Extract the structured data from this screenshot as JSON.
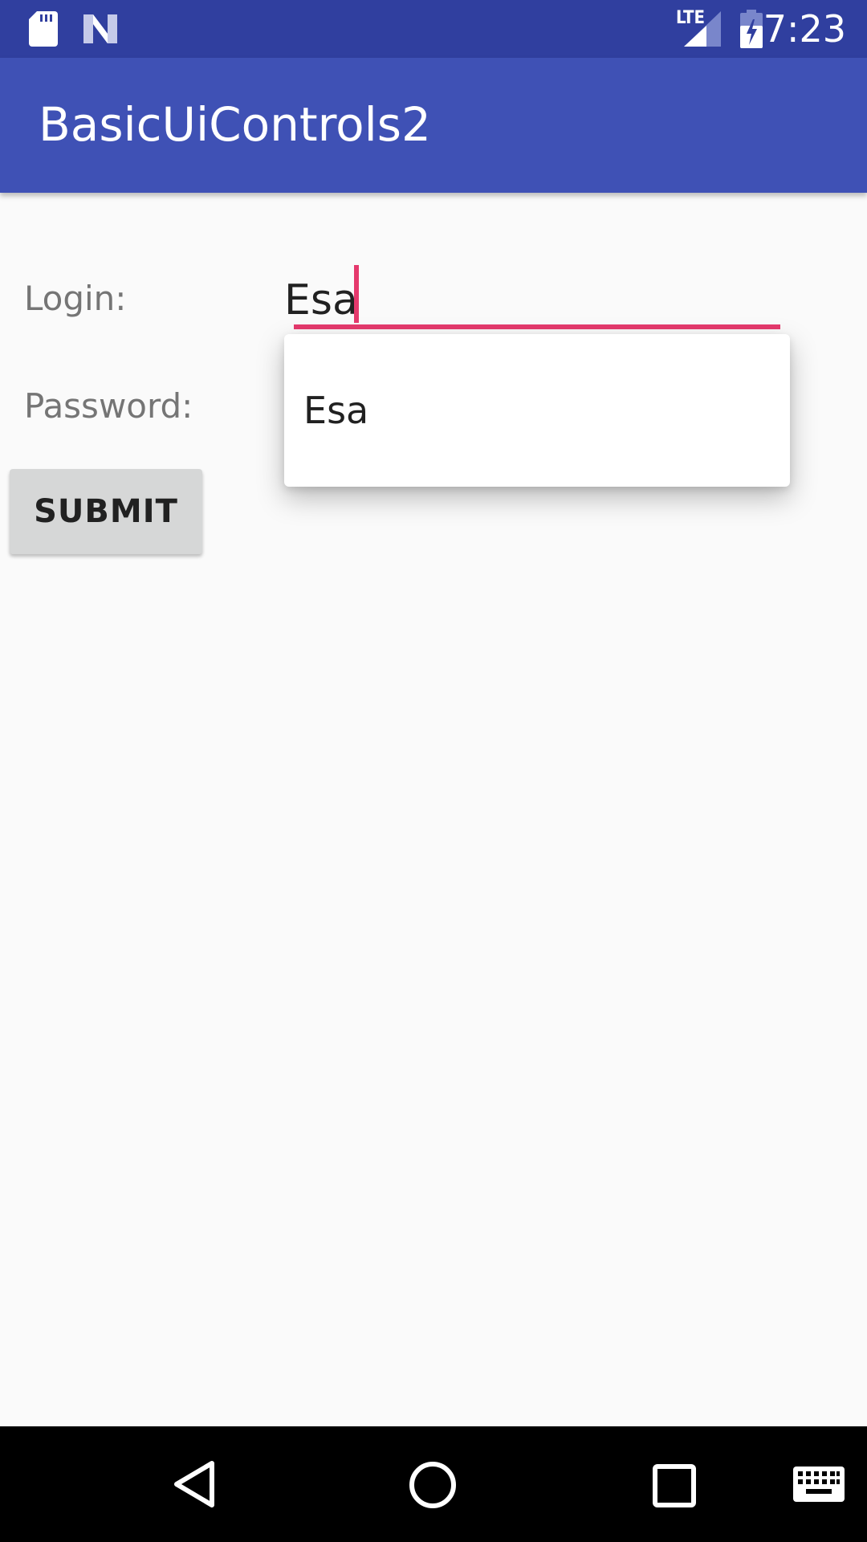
{
  "status_bar": {
    "time": "7:23",
    "network": "LTE",
    "icons": [
      "sd-card-icon",
      "android-n-icon",
      "lte-signal-icon",
      "battery-charging-icon"
    ]
  },
  "app_bar": {
    "title": "BasicUiControls2",
    "color": "#3f51b5"
  },
  "form": {
    "login_label": "Login:",
    "login_value": "Esa",
    "password_label": "Password:",
    "submit_label": "SUBMIT",
    "accent_color": "#e5396d"
  },
  "autocomplete": {
    "suggestions": [
      "Esa"
    ]
  },
  "nav_bar": {
    "icons": [
      "back-icon",
      "home-icon",
      "recents-icon",
      "keyboard-icon"
    ]
  }
}
